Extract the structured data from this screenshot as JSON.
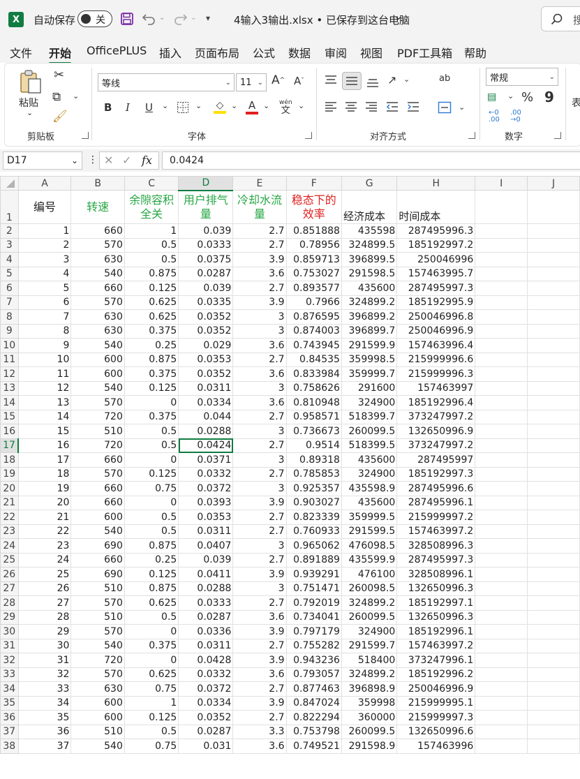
{
  "titlebar": {
    "autosave_label": "自动保存",
    "autosave_state": "关",
    "doc_title": "4输入3输出.xlsx • 已保存到这台电脑",
    "search_label": "搜"
  },
  "menu": [
    "文件",
    "开始",
    "OfficePLUS",
    "插入",
    "页面布局",
    "公式",
    "数据",
    "审阅",
    "视图",
    "PDF工具箱",
    "帮助"
  ],
  "ribbon": {
    "clipboard": {
      "label": "剪贴板",
      "paste": "粘贴"
    },
    "font": {
      "label": "字体",
      "name": "等线",
      "size": "11",
      "bold": "B",
      "italic": "I",
      "underline": "U",
      "grow": "A",
      "shrink": "A",
      "wen": "wén",
      "wen_char": "文"
    },
    "align": {
      "label": "对齐方式",
      "wrap": "ab"
    },
    "number": {
      "label": "数字",
      "format": "常规",
      "percent": "%",
      "comma": "9"
    },
    "more": {
      "label": "表"
    },
    "colors": {
      "fill": "#ffe000",
      "font": "#e02020",
      "accent": "#107c41"
    }
  },
  "formula": {
    "namebox": "D17",
    "fx": "fx",
    "value": "0.0424"
  },
  "grid": {
    "columns": [
      "A",
      "B",
      "C",
      "D",
      "E",
      "F",
      "G",
      "H",
      "I",
      "J"
    ],
    "selected_col": "D",
    "selected_row": "17",
    "headers": {
      "A": "编号",
      "B": "转速",
      "C": "余隙容积全关",
      "D": "用户排气量",
      "E": "冷却水流量",
      "F": "稳态下的效率",
      "G": "经济成本",
      "H": "时间成本"
    },
    "rows": [
      [
        "2",
        "1",
        "660",
        "1",
        "0.039",
        "2.7",
        "0.851888",
        "435598",
        "287495996.3"
      ],
      [
        "3",
        "2",
        "570",
        "0.5",
        "0.0333",
        "2.7",
        "0.78956",
        "324899.5",
        "185192997.2"
      ],
      [
        "4",
        "3",
        "630",
        "0.5",
        "0.0375",
        "3.9",
        "0.859713",
        "396899.5",
        "250046996"
      ],
      [
        "5",
        "4",
        "540",
        "0.875",
        "0.0287",
        "3.6",
        "0.753027",
        "291598.5",
        "157463995.7"
      ],
      [
        "6",
        "5",
        "660",
        "0.125",
        "0.039",
        "2.7",
        "0.893577",
        "435600",
        "287495997.3"
      ],
      [
        "7",
        "6",
        "570",
        "0.625",
        "0.0335",
        "3.9",
        "0.7966",
        "324899.2",
        "185192995.9"
      ],
      [
        "8",
        "7",
        "630",
        "0.625",
        "0.0352",
        "3",
        "0.876595",
        "396899.2",
        "250046996.8"
      ],
      [
        "9",
        "8",
        "630",
        "0.375",
        "0.0352",
        "3",
        "0.874003",
        "396899.7",
        "250046996.9"
      ],
      [
        "10",
        "9",
        "540",
        "0.25",
        "0.029",
        "3.6",
        "0.743945",
        "291599.9",
        "157463996.4"
      ],
      [
        "11",
        "10",
        "600",
        "0.875",
        "0.0353",
        "2.7",
        "0.84535",
        "359998.5",
        "215999996.6"
      ],
      [
        "12",
        "11",
        "600",
        "0.375",
        "0.0352",
        "3.6",
        "0.833984",
        "359999.7",
        "215999996.3"
      ],
      [
        "13",
        "12",
        "540",
        "0.125",
        "0.0311",
        "3",
        "0.758626",
        "291600",
        "157463997"
      ],
      [
        "14",
        "13",
        "570",
        "0",
        "0.0334",
        "3.6",
        "0.810948",
        "324900",
        "185192996.4"
      ],
      [
        "15",
        "14",
        "720",
        "0.375",
        "0.044",
        "2.7",
        "0.958571",
        "518399.7",
        "373247997.2"
      ],
      [
        "16",
        "15",
        "510",
        "0.5",
        "0.0288",
        "3",
        "0.736673",
        "260099.5",
        "132650996.9"
      ],
      [
        "17",
        "16",
        "720",
        "0.5",
        "0.0424",
        "2.7",
        "0.9514",
        "518399.5",
        "373247997.2"
      ],
      [
        "18",
        "17",
        "660",
        "0",
        "0.0371",
        "3",
        "0.89318",
        "435600",
        "287495997"
      ],
      [
        "19",
        "18",
        "570",
        "0.125",
        "0.0332",
        "2.7",
        "0.785853",
        "324900",
        "185192997.3"
      ],
      [
        "20",
        "19",
        "660",
        "0.75",
        "0.0372",
        "3",
        "0.925357",
        "435598.9",
        "287495996.6"
      ],
      [
        "21",
        "20",
        "660",
        "0",
        "0.0393",
        "3.9",
        "0.903027",
        "435600",
        "287495996.1"
      ],
      [
        "22",
        "21",
        "600",
        "0.5",
        "0.0353",
        "2.7",
        "0.823339",
        "359999.5",
        "215999997.2"
      ],
      [
        "23",
        "22",
        "540",
        "0.5",
        "0.0311",
        "2.7",
        "0.760933",
        "291599.5",
        "157463997.2"
      ],
      [
        "24",
        "23",
        "690",
        "0.875",
        "0.0407",
        "3",
        "0.965062",
        "476098.5",
        "328508996.3"
      ],
      [
        "25",
        "24",
        "660",
        "0.25",
        "0.039",
        "2.7",
        "0.891889",
        "435599.9",
        "287495997.3"
      ],
      [
        "26",
        "25",
        "690",
        "0.125",
        "0.0411",
        "3.9",
        "0.939291",
        "476100",
        "328508996.1"
      ],
      [
        "27",
        "26",
        "510",
        "0.875",
        "0.0288",
        "3",
        "0.751471",
        "260098.5",
        "132650996.3"
      ],
      [
        "28",
        "27",
        "570",
        "0.625",
        "0.0333",
        "2.7",
        "0.792019",
        "324899.2",
        "185192997.1"
      ],
      [
        "29",
        "28",
        "510",
        "0.5",
        "0.0287",
        "3.6",
        "0.734041",
        "260099.5",
        "132650996.3"
      ],
      [
        "30",
        "29",
        "570",
        "0",
        "0.0336",
        "3.9",
        "0.797179",
        "324900",
        "185192996.1"
      ],
      [
        "31",
        "30",
        "540",
        "0.375",
        "0.0311",
        "2.7",
        "0.755282",
        "291599.7",
        "157463997.2"
      ],
      [
        "32",
        "31",
        "720",
        "0",
        "0.0428",
        "3.9",
        "0.943236",
        "518400",
        "373247996.1"
      ],
      [
        "33",
        "32",
        "570",
        "0.625",
        "0.0332",
        "3.6",
        "0.793057",
        "324899.2",
        "185192996.2"
      ],
      [
        "34",
        "33",
        "630",
        "0.75",
        "0.0372",
        "2.7",
        "0.877463",
        "396898.9",
        "250046996.9"
      ],
      [
        "35",
        "34",
        "600",
        "1",
        "0.0334",
        "3.9",
        "0.847024",
        "359998",
        "215999995.1"
      ],
      [
        "36",
        "35",
        "600",
        "0.125",
        "0.0352",
        "2.7",
        "0.822294",
        "360000",
        "215999997.3"
      ],
      [
        "37",
        "36",
        "510",
        "0.5",
        "0.0287",
        "3.3",
        "0.753798",
        "260099.5",
        "132650996.6"
      ],
      [
        "38",
        "37",
        "540",
        "0.75",
        "0.031",
        "3.6",
        "0.749521",
        "291598.9",
        "157463996"
      ]
    ]
  }
}
